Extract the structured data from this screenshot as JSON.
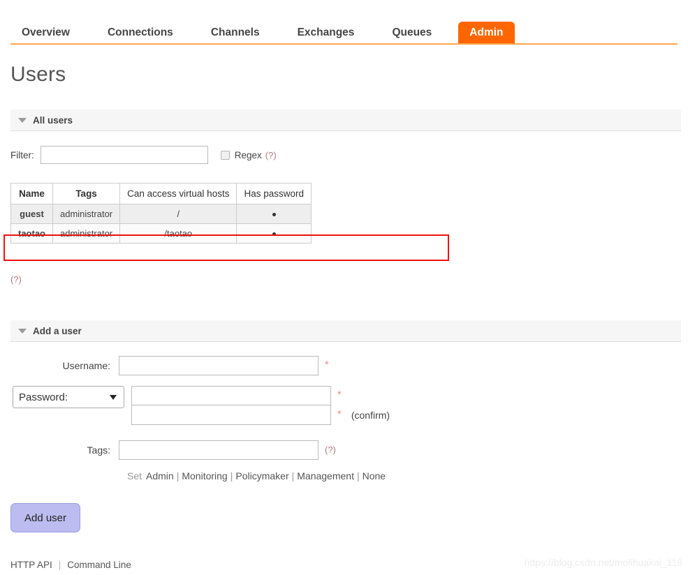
{
  "nav": {
    "tabs": [
      {
        "label": "Overview",
        "active": false
      },
      {
        "label": "Connections",
        "active": false
      },
      {
        "label": "Channels",
        "active": false
      },
      {
        "label": "Exchanges",
        "active": false
      },
      {
        "label": "Queues",
        "active": false
      },
      {
        "label": "Admin",
        "active": true
      }
    ],
    "accent_color": "#ff6600",
    "underline_color": "#ffa64d"
  },
  "page": {
    "title": "Users"
  },
  "all_users": {
    "section_label": "All users",
    "filter_label": "Filter:",
    "filter_value": "",
    "filter_placeholder": "",
    "regex_label": "Regex",
    "regex_hint": "(?)",
    "regex_checked": false,
    "table": {
      "columns": [
        "Name",
        "Tags",
        "Can access virtual hosts",
        "Has password"
      ],
      "rows": [
        {
          "name": "guest",
          "tags": "administrator",
          "vhosts": "/",
          "has_password": "•"
        },
        {
          "name": "taotao",
          "tags": "administrator",
          "vhosts": "/taotao",
          "has_password": "•"
        }
      ]
    },
    "table_hint": "(?)",
    "highlight_color": "#ee1111"
  },
  "add_user": {
    "section_label": "Add a user",
    "username_label": "Username:",
    "username_value": "",
    "username_required": "*",
    "password_select_label": "Password:",
    "password_value": "",
    "password_required": "*",
    "password_confirm_value": "",
    "password_confirm_required": "*",
    "confirm_text": "(confirm)",
    "tags_label": "Tags:",
    "tags_value": "",
    "tags_hint": "(?)",
    "tagset_prefix": "Set",
    "tagset_links": [
      "Admin",
      "Monitoring",
      "Policymaker",
      "Management",
      "None"
    ],
    "tagset_separator": "|",
    "submit_label": "Add user"
  },
  "footer": {
    "links": [
      "HTTP API",
      "Command Line"
    ],
    "separator": "|",
    "watermark": "https://blog.csdn.net/molihuakai_118"
  }
}
